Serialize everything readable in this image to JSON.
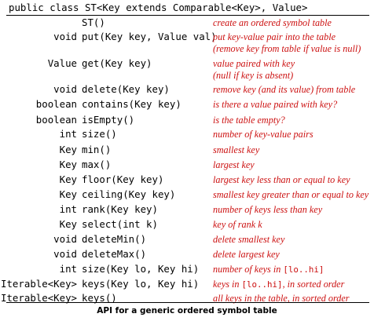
{
  "header": "public class ST<Key extends Comparable<Key>, Value>",
  "rows": [
    {
      "ret": "",
      "sig": "ST()",
      "desc": [
        "create an ordered symbol table"
      ]
    },
    {
      "ret": "void",
      "sig": "put(Key key, Value val)",
      "desc": [
        "put key-value pair into the table",
        "(remove key from table if value is null)"
      ]
    },
    {
      "ret": "Value",
      "sig": "get(Key key)",
      "desc": [
        "value paired with key",
        "(null if key is absent)"
      ]
    },
    {
      "ret": "void",
      "sig": "delete(Key key)",
      "desc": [
        "remove key (and its value) from table"
      ]
    },
    {
      "ret": "boolean",
      "sig": "contains(Key key)",
      "desc": [
        "is there a value paired with key?"
      ]
    },
    {
      "ret": "boolean",
      "sig": "isEmpty()",
      "desc": [
        "is the table empty?"
      ]
    },
    {
      "ret": "int",
      "sig": "size()",
      "desc": [
        "number of key-value pairs"
      ]
    },
    {
      "ret": "Key",
      "sig": "min()",
      "desc": [
        "smallest key"
      ]
    },
    {
      "ret": "Key",
      "sig": "max()",
      "desc": [
        "largest key"
      ]
    },
    {
      "ret": "Key",
      "sig": "floor(Key key)",
      "desc": [
        "largest key less than or equal to key"
      ]
    },
    {
      "ret": "Key",
      "sig": "ceiling(Key key)",
      "desc": [
        "smallest key greater than or equal to key"
      ]
    },
    {
      "ret": "int",
      "sig": "rank(Key key)",
      "desc": [
        "number of keys less than key"
      ]
    },
    {
      "ret": "Key",
      "sig": "select(int k)",
      "desc": [
        "key of rank k"
      ]
    },
    {
      "ret": "void",
      "sig": "deleteMin()",
      "desc": [
        "delete smallest key"
      ]
    },
    {
      "ret": "void",
      "sig": "deleteMax()",
      "desc": [
        "delete largest key"
      ]
    },
    {
      "ret": "int",
      "sig": "size(Key lo, Key hi)",
      "desc": [
        "number of keys in [lo..hi]"
      ]
    },
    {
      "ret": "Iterable<Key>",
      "sig": "keys(Key lo, Key hi)",
      "desc": [
        "keys in [lo..hi], in sorted order"
      ]
    },
    {
      "ret": "Iterable<Key>",
      "sig": "keys()",
      "desc": [
        "all keys in the table, in sorted order"
      ]
    }
  ],
  "caption": "API for a generic ordered symbol table"
}
